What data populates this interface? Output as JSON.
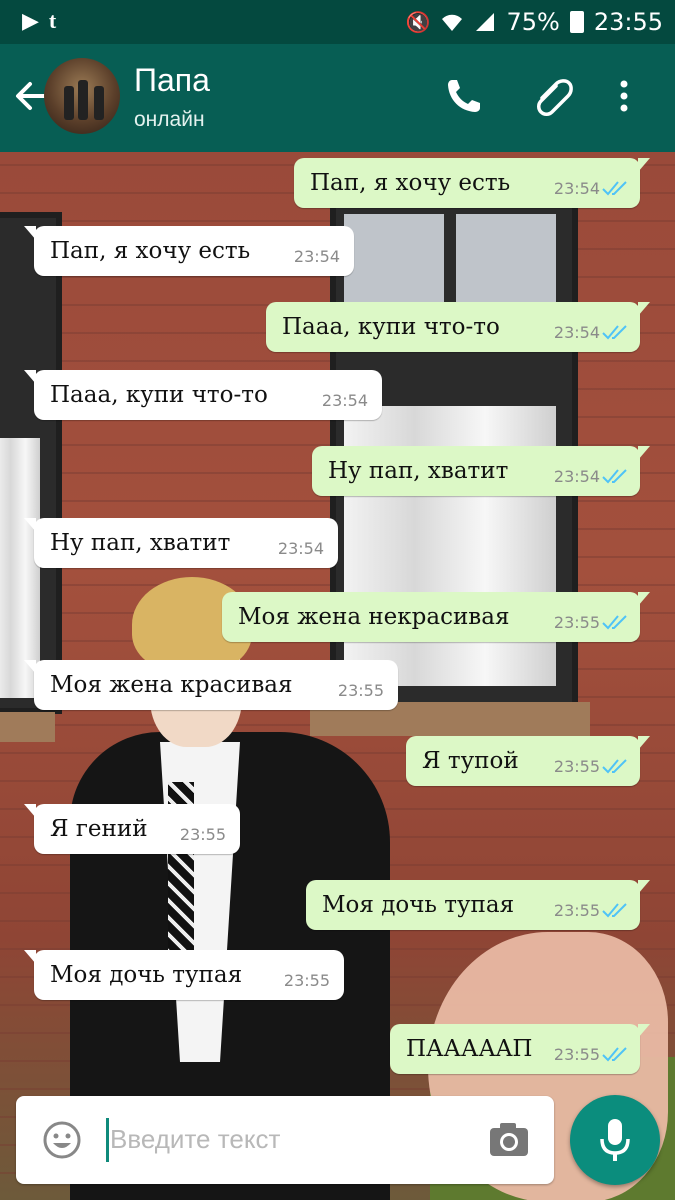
{
  "status_bar": {
    "battery": "75%",
    "time": "23:55",
    "left_icons": [
      "play-store-icon",
      "tumblr-icon"
    ],
    "right_icons": [
      "mute-icon",
      "wifi-icon",
      "signal-icon"
    ]
  },
  "header": {
    "title": "Папа",
    "subtitle": "онлайн",
    "actions": [
      "phone-icon",
      "attach-icon",
      "more-icon"
    ]
  },
  "messages": [
    {
      "dir": "out",
      "text": "Пап, я хочу есть",
      "time": "23:54"
    },
    {
      "dir": "in",
      "text": "Пап, я хочу есть",
      "time": "23:54"
    },
    {
      "dir": "out",
      "text": "Пааа, купи что-то",
      "time": "23:54"
    },
    {
      "dir": "in",
      "text": "Пааа, купи что-то",
      "time": "23:54"
    },
    {
      "dir": "out",
      "text": "Ну пап, хватит",
      "time": "23:54"
    },
    {
      "dir": "in",
      "text": "Ну пап, хватит",
      "time": "23:54"
    },
    {
      "dir": "out",
      "text": "Моя жена некрасивая",
      "time": "23:55"
    },
    {
      "dir": "in",
      "text": "Моя жена красивая",
      "time": "23:55"
    },
    {
      "dir": "out",
      "text": "Я тупой",
      "time": "23:55"
    },
    {
      "dir": "in",
      "text": "Я гений",
      "time": "23:55"
    },
    {
      "dir": "out",
      "text": "Моя дочь тупая",
      "time": "23:55"
    },
    {
      "dir": "in",
      "text": "Моя дочь тупая",
      "time": "23:55"
    },
    {
      "dir": "out",
      "text": "ПААААAП",
      "time": "23:55"
    }
  ],
  "input": {
    "placeholder": "Введите текст"
  },
  "colors": {
    "header": "#075e54",
    "status_bar": "#04493f",
    "outgoing": "#dcf8c6",
    "incoming": "#ffffff",
    "read_ticks": "#4fc3f7",
    "mic_button": "#0b8d7d"
  }
}
